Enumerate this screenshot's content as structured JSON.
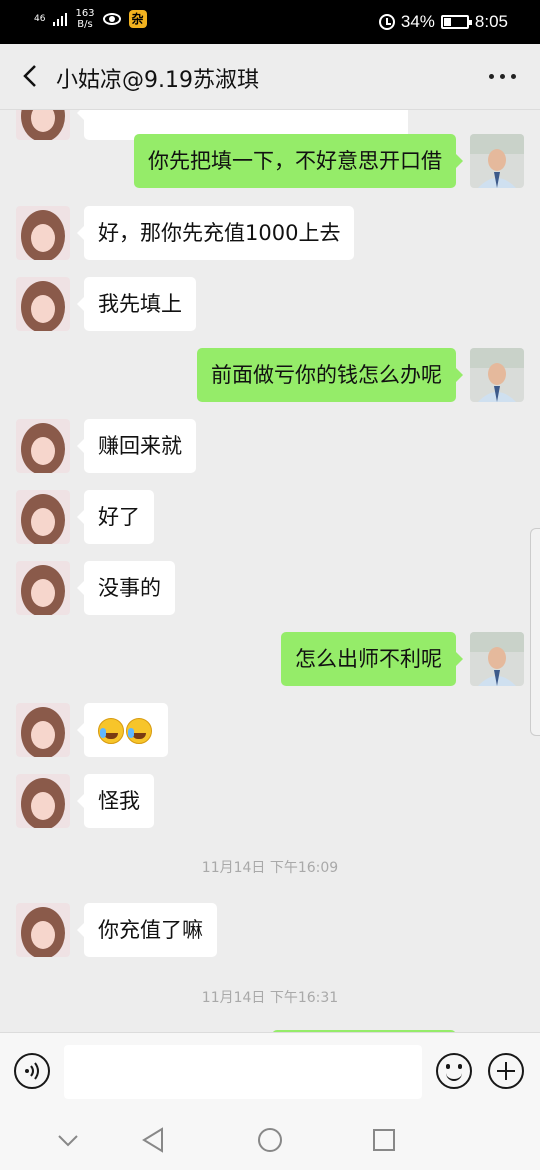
{
  "status_bar": {
    "network": "46",
    "speed_value": "163",
    "speed_unit": "B/s",
    "app_badge": "杂",
    "battery": "34%",
    "battery_level": 0.34,
    "time": "8:05"
  },
  "header": {
    "title": "小姑凉@9.19苏淑琪"
  },
  "messages": [
    {
      "side": "out",
      "text": "你先把填一下，不好意思开口借"
    },
    {
      "side": "in",
      "text": "好，那你先充值1000上去"
    },
    {
      "side": "in",
      "text": "我先填上"
    },
    {
      "side": "out",
      "text": "前面做亏你的钱怎么办呢"
    },
    {
      "side": "in",
      "text": "赚回来就"
    },
    {
      "side": "in",
      "text": "好了"
    },
    {
      "side": "in",
      "text": "没事的"
    },
    {
      "side": "out",
      "text": "怎么出师不利呢"
    },
    {
      "side": "in",
      "emoji_count": 2,
      "emoji": "laugh-cry-emoji"
    },
    {
      "side": "in",
      "text": "怪我"
    },
    {
      "side": "in",
      "text": "你充值了嘛"
    }
  ],
  "timestamps": [
    "11月14日 下午16:09",
    "11月14日 下午16:31"
  ],
  "colors": {
    "outgoing_bubble": "#95ec69",
    "incoming_bubble": "#ffffff",
    "background": "#ededed"
  }
}
